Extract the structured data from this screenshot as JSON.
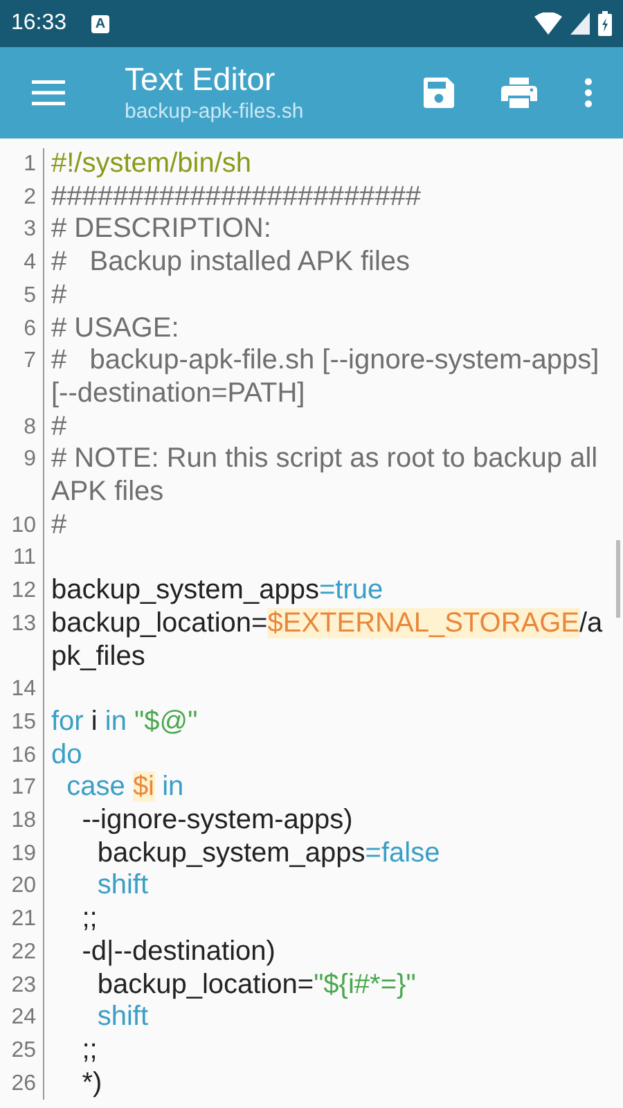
{
  "status_bar": {
    "time": "16:33",
    "notification": "A"
  },
  "app_bar": {
    "title": "Text Editor",
    "subtitle": "backup-apk-files.sh"
  },
  "lines": [
    {
      "number": "1",
      "segments": [
        {
          "kind": "shebang",
          "text": "#!/system/bin/sh"
        }
      ]
    },
    {
      "number": "2",
      "segments": [
        {
          "kind": "comment",
          "text": "########################"
        }
      ]
    },
    {
      "number": "3",
      "segments": [
        {
          "kind": "comment",
          "text": "# DESCRIPTION:"
        }
      ]
    },
    {
      "number": "4",
      "segments": [
        {
          "kind": "comment",
          "text": "#   Backup installed APK files"
        }
      ]
    },
    {
      "number": "5",
      "segments": [
        {
          "kind": "comment",
          "text": "#"
        }
      ]
    },
    {
      "number": "6",
      "segments": [
        {
          "kind": "comment",
          "text": "# USAGE:"
        }
      ]
    },
    {
      "number": "7",
      "segments": [
        {
          "kind": "comment",
          "text": "#   backup-apk-file.sh [--ignore-system-apps] [--destination=PATH]"
        }
      ]
    },
    {
      "number": "8",
      "segments": [
        {
          "kind": "comment",
          "text": "#"
        }
      ]
    },
    {
      "number": "9",
      "segments": [
        {
          "kind": "comment",
          "text": "# NOTE: Run this script as root to backup all APK files"
        }
      ]
    },
    {
      "number": "10",
      "segments": [
        {
          "kind": "comment",
          "text": "#"
        }
      ]
    },
    {
      "number": "11"
    },
    {
      "number": "12",
      "segments": [
        {
          "kind": "plain",
          "text": "backup_system_apps"
        },
        {
          "kind": "keyword",
          "text": "=true"
        }
      ]
    },
    {
      "number": "13",
      "segments": [
        {
          "kind": "plain",
          "text": "backup_location="
        },
        {
          "kind": "variable",
          "text": "$EXTERNAL_STORAGE"
        },
        {
          "kind": "plain",
          "text": "/apk_files"
        }
      ]
    },
    {
      "number": "14"
    },
    {
      "number": "15",
      "segments": [
        {
          "kind": "keyword",
          "text": "for"
        },
        {
          "kind": "plain",
          "text": " i "
        },
        {
          "kind": "keyword",
          "text": "in"
        },
        {
          "kind": "string",
          "text": " \"$@\""
        }
      ]
    },
    {
      "number": "16",
      "segments": [
        {
          "kind": "keyword",
          "text": "do"
        }
      ]
    },
    {
      "number": "17",
      "segments": [
        {
          "kind": "keyword",
          "text": "  case "
        },
        {
          "kind": "variable",
          "text": "$i"
        },
        {
          "kind": "keyword",
          "text": " in"
        }
      ]
    },
    {
      "number": "18",
      "segments": [
        {
          "kind": "plain",
          "text": "    --ignore-system-apps)"
        }
      ]
    },
    {
      "number": "19",
      "segments": [
        {
          "kind": "plain",
          "text": "      backup_system_apps"
        },
        {
          "kind": "keyword",
          "text": "=false"
        }
      ]
    },
    {
      "number": "20",
      "segments": [
        {
          "kind": "keyword",
          "text": "      shift"
        }
      ]
    },
    {
      "number": "21",
      "segments": [
        {
          "kind": "plain",
          "text": "    ;;"
        }
      ]
    },
    {
      "number": "22",
      "segments": [
        {
          "kind": "plain",
          "text": "    -d|--destination)"
        }
      ]
    },
    {
      "number": "23",
      "segments": [
        {
          "kind": "plain",
          "text": "      backup_location="
        },
        {
          "kind": "string",
          "text": "\"${i#*=}\""
        }
      ]
    },
    {
      "number": "24",
      "segments": [
        {
          "kind": "keyword",
          "text": "      shift"
        }
      ]
    },
    {
      "number": "25",
      "segments": [
        {
          "kind": "plain",
          "text": "    ;;"
        }
      ]
    },
    {
      "number": "26",
      "segments": [
        {
          "kind": "plain",
          "text": "    *)"
        }
      ]
    }
  ]
}
